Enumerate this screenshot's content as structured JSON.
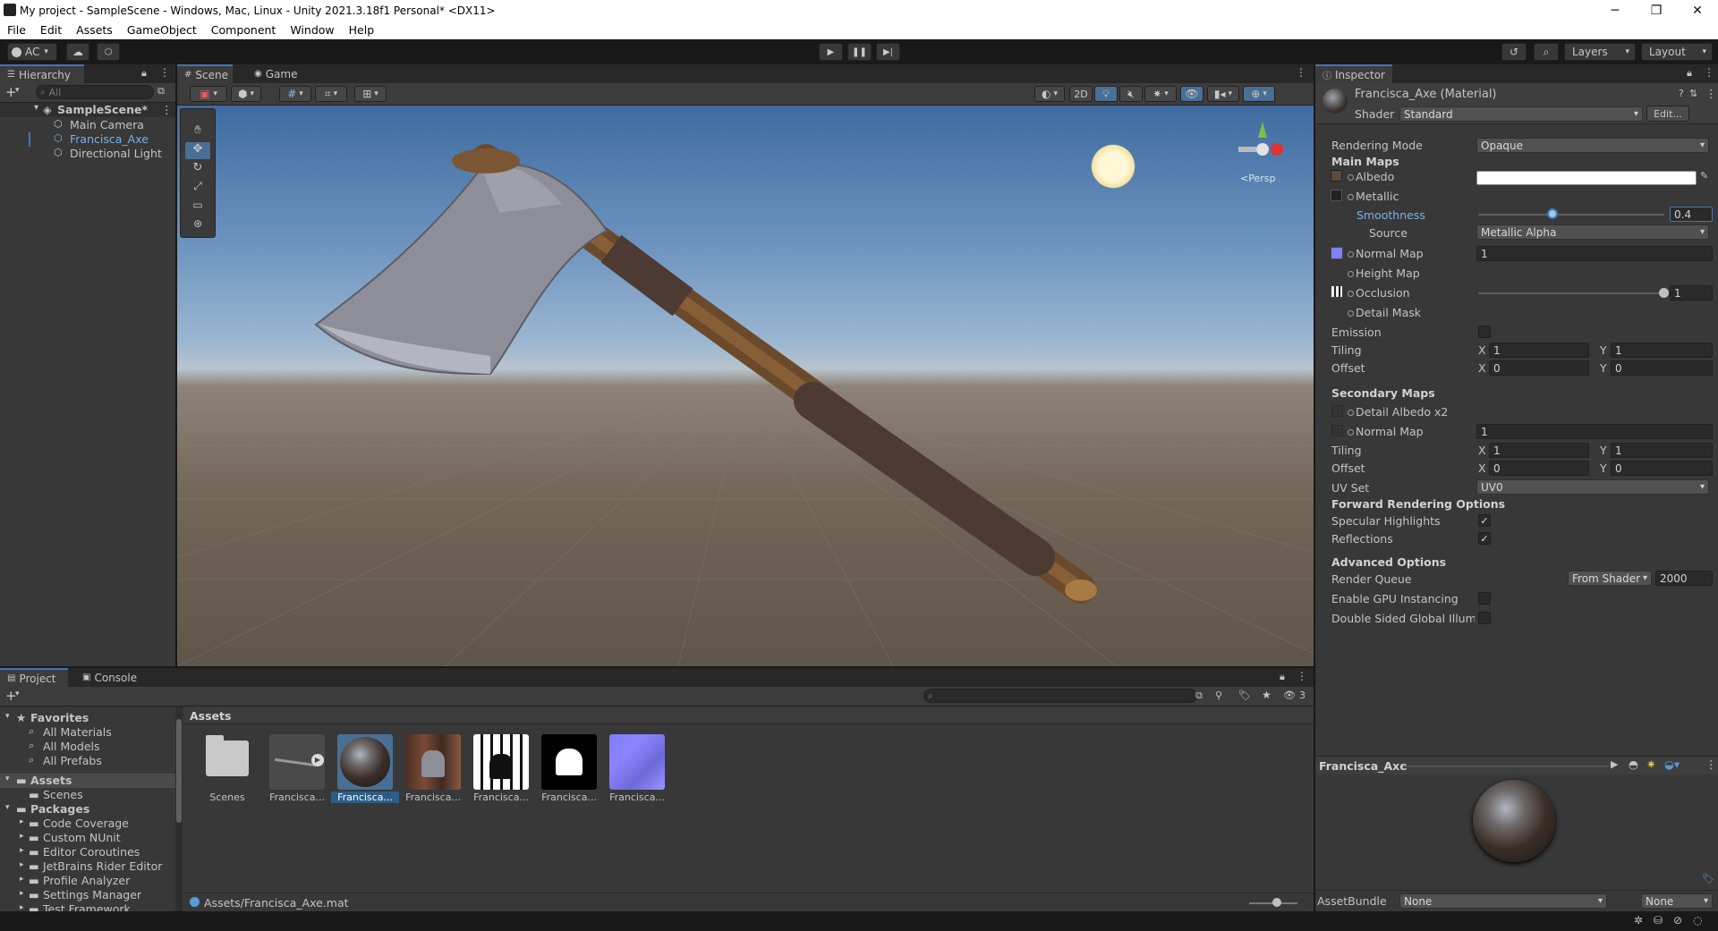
{
  "window": {
    "title": "My project - SampleScene - Windows, Mac, Linux - Unity 2021.3.18f1 Personal* <DX11>",
    "minimize": "─",
    "maximize": "❐",
    "close": "✕"
  },
  "menu": [
    "File",
    "Edit",
    "Assets",
    "GameObject",
    "Component",
    "Window",
    "Help"
  ],
  "toolbar": {
    "account": "AC",
    "layers": "Layers",
    "layout": "Layout"
  },
  "hierarchy": {
    "tab": "Hierarchy",
    "search_placeholder": "All",
    "scene": "SampleScene*",
    "items": [
      "Main Camera",
      "Francisca_Axe",
      "Directional Light"
    ]
  },
  "scene_view": {
    "tabs": [
      "Scene",
      "Game"
    ],
    "mode_2d": "2D",
    "persp": "<Persp"
  },
  "inspector": {
    "tab": "Inspector",
    "object": "Francisca_Axe (Material)",
    "shader_label": "Shader",
    "shader": "Standard",
    "edit": "Edit...",
    "rendering_mode_label": "Rendering Mode",
    "rendering_mode": "Opaque",
    "main_maps": "Main Maps",
    "albedo": "Albedo",
    "metallic": "Metallic",
    "smoothness": "Smoothness",
    "smoothness_value": "0.4",
    "smoothness_fraction": 0.4,
    "source_label": "Source",
    "source": "Metallic Alpha",
    "normal_map": "Normal Map",
    "normal_map_value": "1",
    "height_map": "Height Map",
    "occlusion": "Occlusion",
    "occlusion_value": "1",
    "detail_mask": "Detail Mask",
    "emission": "Emission",
    "tiling": "Tiling",
    "offset": "Offset",
    "x": "X",
    "y": "Y",
    "tiling_x": "1",
    "tiling_y": "1",
    "offset_x": "0",
    "offset_y": "0",
    "secondary_maps": "Secondary Maps",
    "detail_albedo": "Detail Albedo x2",
    "normal_map2": "Normal Map",
    "normal_map2_value": "1",
    "tiling2_x": "1",
    "tiling2_y": "1",
    "offset2_x": "0",
    "offset2_y": "0",
    "uv_set_label": "UV Set",
    "uv_set": "UV0",
    "forward_options": "Forward Rendering Options",
    "specular": "Specular Highlights",
    "reflections": "Reflections",
    "advanced": "Advanced Options",
    "render_queue": "Render Queue",
    "render_queue_source": "From Shader",
    "render_queue_value": "2000",
    "gpu_instancing": "Enable GPU Instancing",
    "double_sided": "Double Sided Global Illuminat",
    "preview_title": "Francisca_Axe",
    "assetbundle_label": "AssetBundle",
    "assetbundle": "None",
    "assetbundle_variant": "None"
  },
  "project": {
    "tabs": [
      "Project",
      "Console"
    ],
    "search_count": "3",
    "favorites": "Favorites",
    "favorite_items": [
      "All Materials",
      "All Models",
      "All Prefabs"
    ],
    "assets": "Assets",
    "asset_folders": [
      "Scenes"
    ],
    "packages": "Packages",
    "package_items": [
      "Code Coverage",
      "Custom NUnit",
      "Editor Coroutines",
      "JetBrains Rider Editor",
      "Profile Analyzer",
      "Settings Manager",
      "Test Framework"
    ],
    "breadcrumb": "Assets",
    "thumbs": [
      "Scenes",
      "Francisca...",
      "Francisca...",
      "Francisca...",
      "Francisca...",
      "Francisca...",
      "Francisca..."
    ],
    "path": "Assets/Francisca_Axe.mat"
  },
  "colors": {
    "accent": "#3a79bb",
    "selection": "#2c5d87",
    "normal_map_swatch": "#8080ff"
  }
}
